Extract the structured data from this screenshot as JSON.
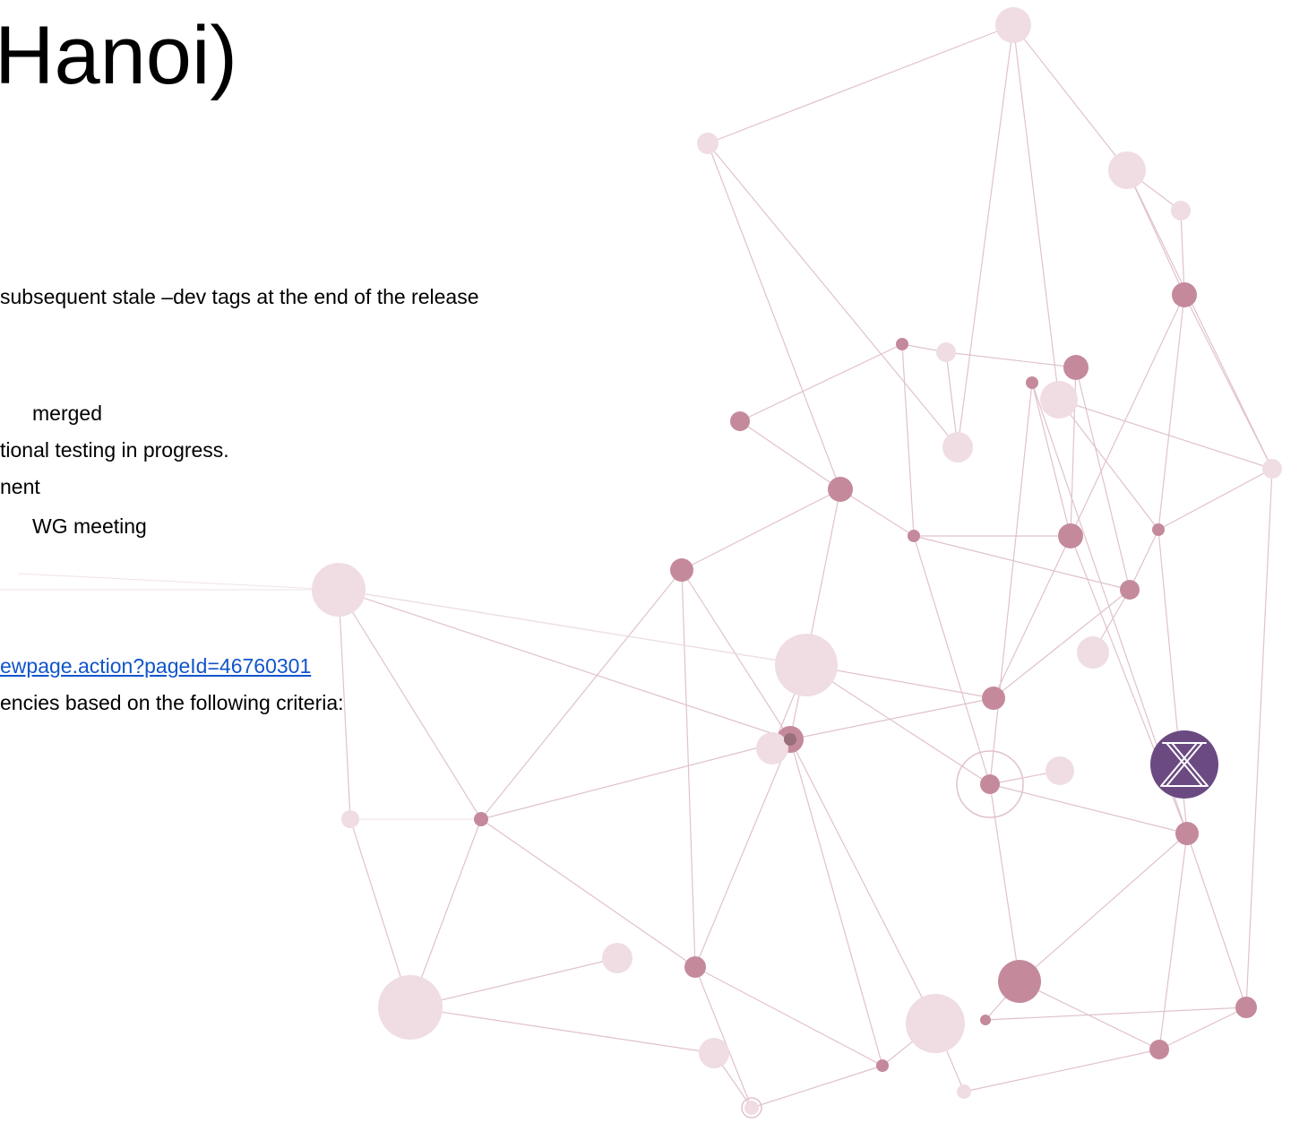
{
  "slide": {
    "title": "Hanoi)",
    "lines": [
      "subsequent stale –dev tags at the end of the release",
      "merged",
      "tional testing in progress.",
      "nent",
      "WG meeting"
    ],
    "link_text": "ewpage.action?pageId=46760301",
    "criteria_text": "encies based on the following criteria:"
  },
  "colors": {
    "node_dark": "#c48a9b",
    "node_light": "#efdde3",
    "edge": "#e0c2cc",
    "logo": "#6b4a82",
    "link": "#1155cc"
  },
  "logo": {
    "icon": "x-logo-icon"
  }
}
